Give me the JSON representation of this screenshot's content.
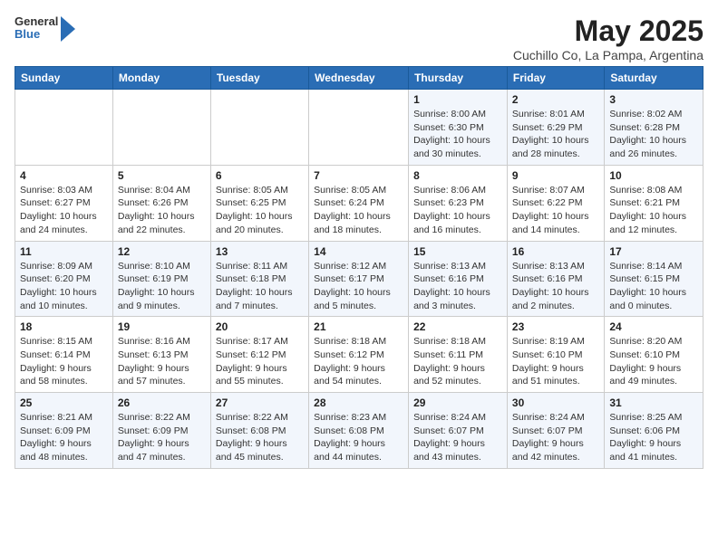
{
  "logo": {
    "general": "General",
    "blue": "Blue"
  },
  "title": "May 2025",
  "subtitle": "Cuchillo Co, La Pampa, Argentina",
  "days_of_week": [
    "Sunday",
    "Monday",
    "Tuesday",
    "Wednesday",
    "Thursday",
    "Friday",
    "Saturday"
  ],
  "weeks": [
    [
      {
        "day": "",
        "content": ""
      },
      {
        "day": "",
        "content": ""
      },
      {
        "day": "",
        "content": ""
      },
      {
        "day": "",
        "content": ""
      },
      {
        "day": "1",
        "content": "Sunrise: 8:00 AM\nSunset: 6:30 PM\nDaylight: 10 hours\nand 30 minutes."
      },
      {
        "day": "2",
        "content": "Sunrise: 8:01 AM\nSunset: 6:29 PM\nDaylight: 10 hours\nand 28 minutes."
      },
      {
        "day": "3",
        "content": "Sunrise: 8:02 AM\nSunset: 6:28 PM\nDaylight: 10 hours\nand 26 minutes."
      }
    ],
    [
      {
        "day": "4",
        "content": "Sunrise: 8:03 AM\nSunset: 6:27 PM\nDaylight: 10 hours\nand 24 minutes."
      },
      {
        "day": "5",
        "content": "Sunrise: 8:04 AM\nSunset: 6:26 PM\nDaylight: 10 hours\nand 22 minutes."
      },
      {
        "day": "6",
        "content": "Sunrise: 8:05 AM\nSunset: 6:25 PM\nDaylight: 10 hours\nand 20 minutes."
      },
      {
        "day": "7",
        "content": "Sunrise: 8:05 AM\nSunset: 6:24 PM\nDaylight: 10 hours\nand 18 minutes."
      },
      {
        "day": "8",
        "content": "Sunrise: 8:06 AM\nSunset: 6:23 PM\nDaylight: 10 hours\nand 16 minutes."
      },
      {
        "day": "9",
        "content": "Sunrise: 8:07 AM\nSunset: 6:22 PM\nDaylight: 10 hours\nand 14 minutes."
      },
      {
        "day": "10",
        "content": "Sunrise: 8:08 AM\nSunset: 6:21 PM\nDaylight: 10 hours\nand 12 minutes."
      }
    ],
    [
      {
        "day": "11",
        "content": "Sunrise: 8:09 AM\nSunset: 6:20 PM\nDaylight: 10 hours\nand 10 minutes."
      },
      {
        "day": "12",
        "content": "Sunrise: 8:10 AM\nSunset: 6:19 PM\nDaylight: 10 hours\nand 9 minutes."
      },
      {
        "day": "13",
        "content": "Sunrise: 8:11 AM\nSunset: 6:18 PM\nDaylight: 10 hours\nand 7 minutes."
      },
      {
        "day": "14",
        "content": "Sunrise: 8:12 AM\nSunset: 6:17 PM\nDaylight: 10 hours\nand 5 minutes."
      },
      {
        "day": "15",
        "content": "Sunrise: 8:13 AM\nSunset: 6:16 PM\nDaylight: 10 hours\nand 3 minutes."
      },
      {
        "day": "16",
        "content": "Sunrise: 8:13 AM\nSunset: 6:16 PM\nDaylight: 10 hours\nand 2 minutes."
      },
      {
        "day": "17",
        "content": "Sunrise: 8:14 AM\nSunset: 6:15 PM\nDaylight: 10 hours\nand 0 minutes."
      }
    ],
    [
      {
        "day": "18",
        "content": "Sunrise: 8:15 AM\nSunset: 6:14 PM\nDaylight: 9 hours\nand 58 minutes."
      },
      {
        "day": "19",
        "content": "Sunrise: 8:16 AM\nSunset: 6:13 PM\nDaylight: 9 hours\nand 57 minutes."
      },
      {
        "day": "20",
        "content": "Sunrise: 8:17 AM\nSunset: 6:12 PM\nDaylight: 9 hours\nand 55 minutes."
      },
      {
        "day": "21",
        "content": "Sunrise: 8:18 AM\nSunset: 6:12 PM\nDaylight: 9 hours\nand 54 minutes."
      },
      {
        "day": "22",
        "content": "Sunrise: 8:18 AM\nSunset: 6:11 PM\nDaylight: 9 hours\nand 52 minutes."
      },
      {
        "day": "23",
        "content": "Sunrise: 8:19 AM\nSunset: 6:10 PM\nDaylight: 9 hours\nand 51 minutes."
      },
      {
        "day": "24",
        "content": "Sunrise: 8:20 AM\nSunset: 6:10 PM\nDaylight: 9 hours\nand 49 minutes."
      }
    ],
    [
      {
        "day": "25",
        "content": "Sunrise: 8:21 AM\nSunset: 6:09 PM\nDaylight: 9 hours\nand 48 minutes."
      },
      {
        "day": "26",
        "content": "Sunrise: 8:22 AM\nSunset: 6:09 PM\nDaylight: 9 hours\nand 47 minutes."
      },
      {
        "day": "27",
        "content": "Sunrise: 8:22 AM\nSunset: 6:08 PM\nDaylight: 9 hours\nand 45 minutes."
      },
      {
        "day": "28",
        "content": "Sunrise: 8:23 AM\nSunset: 6:08 PM\nDaylight: 9 hours\nand 44 minutes."
      },
      {
        "day": "29",
        "content": "Sunrise: 8:24 AM\nSunset: 6:07 PM\nDaylight: 9 hours\nand 43 minutes."
      },
      {
        "day": "30",
        "content": "Sunrise: 8:24 AM\nSunset: 6:07 PM\nDaylight: 9 hours\nand 42 minutes."
      },
      {
        "day": "31",
        "content": "Sunrise: 8:25 AM\nSunset: 6:06 PM\nDaylight: 9 hours\nand 41 minutes."
      }
    ]
  ]
}
